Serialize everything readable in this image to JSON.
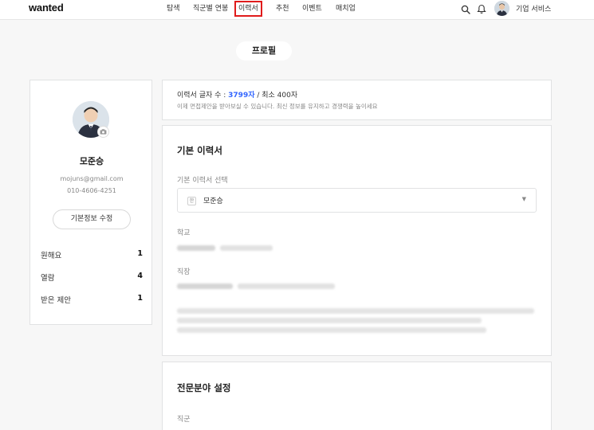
{
  "nav": {
    "logo": "wanted",
    "items": [
      "탐색",
      "직군별 연봉",
      "이력서",
      "추천",
      "이벤트",
      "매치업"
    ],
    "active_index": 2,
    "business": "기업 서비스"
  },
  "profile_pill": "프로필",
  "profile": {
    "name": "모준승",
    "email": "mojuns@gmail.com",
    "phone": "010-4606-4251",
    "edit_button": "기본정보 수정",
    "stats": [
      {
        "label": "원해요",
        "value": "1"
      },
      {
        "label": "열람",
        "value": "4"
      },
      {
        "label": "받은 제안",
        "value": "1"
      }
    ]
  },
  "resume_count": {
    "prefix": "이력서 글자 수 : ",
    "count": "3799자",
    "suffix": " / 최소 400자",
    "note": "이제 면접제안을 받아보실 수 있습니다. 최신 정보를 유지하고 경쟁력을 높이세요"
  },
  "basic_resume": {
    "title": "기본 이력서",
    "select_label": "기본 이력서 선택",
    "select_icon": "한",
    "select_value": "모준승",
    "school_label": "학교",
    "job_label": "직장"
  },
  "specialty": {
    "title": "전문분야 설정",
    "job_group_label": "직군"
  },
  "colors": {
    "highlight_box": "#e01b1b",
    "count_accent": "#3366ff"
  }
}
